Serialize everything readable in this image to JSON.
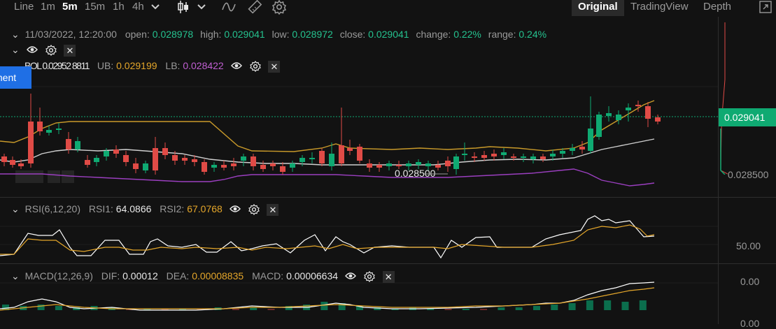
{
  "toolbar": {
    "intervals": [
      "Line",
      "1m",
      "5m",
      "15m",
      "1h",
      "4h"
    ],
    "active_interval": "5m",
    "views": [
      "Original",
      "TradingView",
      "Depth"
    ],
    "active_view": "Original"
  },
  "main_legend": {
    "datetime": "11/03/2022, 12:20:00",
    "open_label": "open:",
    "open": "0.028978",
    "high_label": "high:",
    "high": "0.029041",
    "low_label": "low:",
    "low": "0.028972",
    "close_label": "close:",
    "close": "0.029041",
    "change_label": "change:",
    "change": "0.22%",
    "range_label": "range:",
    "range": "0.24%"
  },
  "boll_legend": {
    "overlap_text": "BOL 0.02952 8811",
    "ub_label": "UB:",
    "ub": "0.029199",
    "lb_label": "LB:",
    "lb": "0.028422"
  },
  "blue_tag": "ment",
  "price_axis": {
    "current_price": "0.029041",
    "lower_price": "0.028500"
  },
  "low_marker": "0.028500",
  "rsi_legend": {
    "name": "RSI(6,12,20)",
    "rsi1_label": "RSI1:",
    "rsi1": "64.0866",
    "rsi2_label": "RSI2:",
    "rsi2": "67.0768",
    "axis_value": "50.00"
  },
  "macd_legend": {
    "name": "MACD(12,26,9)",
    "dif_label": "DIF:",
    "dif": "0.00012",
    "dea_label": "DEA:",
    "dea": "0.00008835",
    "macd_label": "MACD:",
    "macd": "0.00006634",
    "axis_top": "0.00",
    "axis_bottom": "0.00"
  },
  "colors": {
    "up": "#0faa72",
    "down": "#e04b46",
    "boll_mid": "#d0d0d0",
    "boll_ub": "#c99a2a",
    "boll_lb": "#9b3fc0",
    "rsi1": "#ffffff",
    "rsi2": "#e4a62a"
  },
  "chart_data": [
    {
      "type": "line",
      "title": "",
      "series": [
        {
          "name": "RSI1",
          "values": [
            52,
            63,
            63,
            65,
            52,
            58,
            52,
            58,
            60,
            55,
            52,
            55,
            54,
            58,
            52,
            55,
            56,
            58,
            48,
            55,
            60,
            70,
            52,
            66,
            50,
            55,
            57,
            60,
            53,
            52,
            48,
            55,
            64,
            61,
            73,
            80,
            79,
            72,
            65,
            64
          ]
        },
        {
          "name": "RSI2",
          "values": [
            55,
            60,
            60,
            62,
            55,
            56,
            55,
            56,
            57,
            55,
            54,
            55,
            55,
            56,
            54,
            55,
            55,
            56,
            52,
            54,
            57,
            62,
            56,
            60,
            53,
            54,
            55,
            56,
            54,
            53,
            52,
            54,
            58,
            58,
            66,
            73,
            72,
            70,
            66,
            67
          ]
        }
      ],
      "ylabel": "",
      "xlabel": ""
    },
    {
      "type": "bar",
      "title": "",
      "series": [
        {
          "name": "MACD",
          "values": [
            4e-05,
            3e-05,
            4e-05,
            3e-05,
            2e-05,
            3e-05,
            2e-05,
            1e-05,
            1e-05,
            0.0,
            1e-05,
            1e-05,
            2e-05,
            1e-05,
            2e-05,
            1e-05,
            3e-05,
            4e-05,
            6e-05,
            5e-05,
            3e-05,
            2e-05,
            1e-05,
            2e-05,
            1e-05,
            0.0,
            1e-05,
            1e-05,
            2e-05,
            2e-05,
            3e-05,
            4e-05,
            5e-05,
            7e-05,
            7e-05,
            6e-05,
            7e-05
          ]
        }
      ]
    }
  ]
}
